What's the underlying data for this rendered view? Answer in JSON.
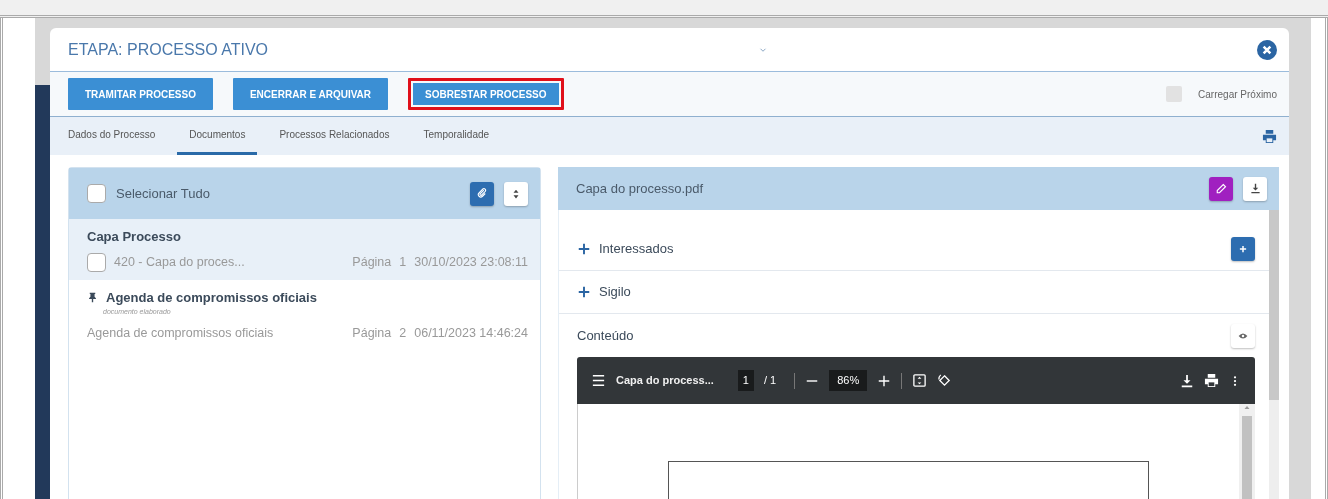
{
  "modal": {
    "title": "ETAPA: PROCESSO ATIVO"
  },
  "actions": [
    {
      "label": "TRAMITAR PROCESSO",
      "highlighted": false
    },
    {
      "label": "ENCERRAR E ARQUIVAR",
      "highlighted": false
    },
    {
      "label": "SOBRESTAR PROCESSO",
      "highlighted": true
    }
  ],
  "load_next": {
    "label": "Carregar Próximo",
    "checked": false
  },
  "tabs": [
    {
      "label": "Dados do Processo",
      "selected": false
    },
    {
      "label": "Documentos",
      "selected": true
    },
    {
      "label": "Processos Relacionados",
      "selected": false
    },
    {
      "label": "Temporalidade",
      "selected": false
    }
  ],
  "documents": {
    "select_all": {
      "label": "Selecionar Tudo",
      "checked": false
    },
    "groups": [
      {
        "title": "Capa Processo",
        "pinned": false,
        "selected": true,
        "items": [
          {
            "kind": "checkbox",
            "checked": false,
            "name": "420 - Capa do proces...",
            "page_label": "Página",
            "page": "1",
            "date": "30/10/2023 23:08:11"
          }
        ]
      },
      {
        "title": "Agenda de compromissos oficiais",
        "pinned": true,
        "subtitle": "documento elaborado",
        "selected": false,
        "items": [
          {
            "kind": "plain",
            "name": "Agenda de compromissos oficiais",
            "page_label": "Página",
            "page": "2",
            "date": "06/11/2023 14:46:24"
          }
        ]
      }
    ]
  },
  "viewer": {
    "filename": "Capa do processo.pdf",
    "sections": [
      {
        "kind": "expandable",
        "label": "Interessados",
        "expanded": false,
        "add_button": true
      },
      {
        "kind": "expandable",
        "label": "Sigilo",
        "expanded": false,
        "add_button": false
      },
      {
        "kind": "content",
        "label": "Conteúdo"
      }
    ],
    "pdf": {
      "title": "Capa do process...",
      "page": "1",
      "page_of": "/ 1",
      "zoom": "86%"
    }
  }
}
